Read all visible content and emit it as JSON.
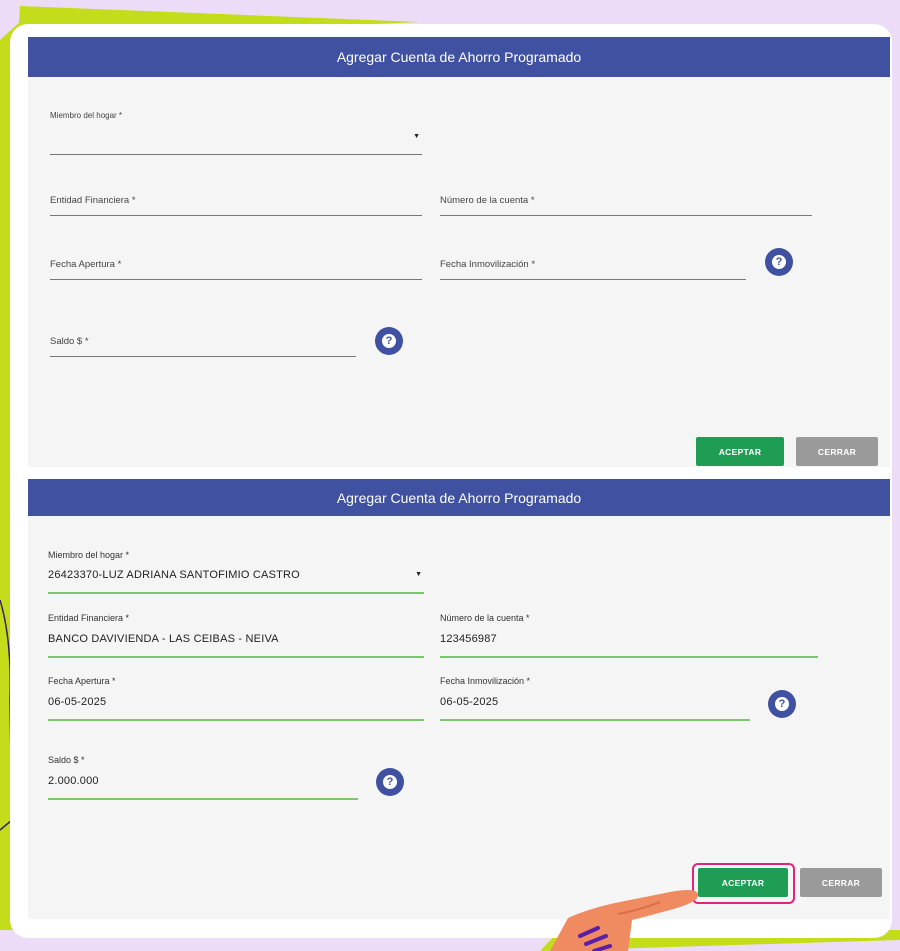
{
  "colors": {
    "page_bg": "#ecdcf7",
    "accent_green": "#c4dd1b",
    "header_blue": "#3f51a0",
    "accept_green": "#1f9d55",
    "close_gray": "#9a9a9a",
    "highlight_pink": "#e0247a"
  },
  "form_empty": {
    "title": "Agregar Cuenta de Ahorro Programado",
    "member_label": "Miembro del hogar *",
    "entity_label": "Entidad Financiera *",
    "account_label": "Número de la cuenta *",
    "opening_date_label": "Fecha Apertura *",
    "freeze_date_label": "Fecha Inmovilización *",
    "balance_label": "Saldo $ *",
    "accept_label": "ACEPTAR",
    "close_label": "CERRAR"
  },
  "form_filled": {
    "title": "Agregar Cuenta de Ahorro Programado",
    "member_label": "Miembro del hogar *",
    "member_value": "26423370-LUZ ADRIANA SANTOFIMIO CASTRO",
    "entity_label": "Entidad Financiera *",
    "entity_value": "BANCO DAVIVIENDA - LAS CEIBAS - NEIVA",
    "account_label": "Número de la cuenta *",
    "account_value": "123456987",
    "opening_date_label": "Fecha Apertura *",
    "opening_date_value": "06-05-2025",
    "freeze_date_label": "Fecha Inmovilización *",
    "freeze_date_value": "06-05-2025",
    "balance_label": "Saldo $ *",
    "balance_value": "2.000.000",
    "accept_label": "ACEPTAR",
    "close_label": "CERRAR"
  },
  "icons": {
    "help": "help-circle-icon",
    "dropdown": "caret-down-icon",
    "pointer": "pointing-hand-icon"
  },
  "glyphs": {
    "help": "?",
    "dropdown": "▼"
  }
}
